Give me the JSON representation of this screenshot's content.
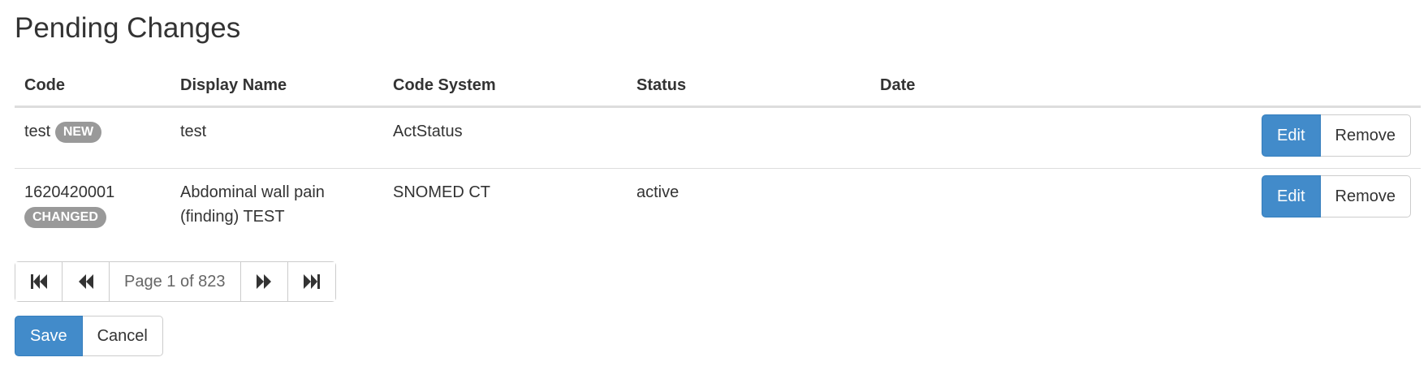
{
  "page": {
    "title": "Pending Changes"
  },
  "table": {
    "headers": {
      "code": "Code",
      "display_name": "Display Name",
      "code_system": "Code System",
      "status": "Status",
      "date": "Date"
    },
    "rows": [
      {
        "code": "test",
        "badge": "NEW",
        "display_name": "test",
        "display_name_line2": "",
        "code_system": "ActStatus",
        "status": "",
        "date": "",
        "edit_label": "Edit",
        "remove_label": "Remove"
      },
      {
        "code": "1620420001",
        "badge": "CHANGED",
        "display_name": "Abdominal wall pain",
        "display_name_line2": "(finding) TEST",
        "code_system": "SNOMED CT",
        "status": "active",
        "date": "",
        "edit_label": "Edit",
        "remove_label": "Remove"
      }
    ]
  },
  "pager": {
    "indicator": "Page 1 of 823",
    "first_icon": "first-page-icon",
    "prev_icon": "previous-page-icon",
    "next_icon": "next-page-icon",
    "last_icon": "last-page-icon"
  },
  "form": {
    "save_label": "Save",
    "cancel_label": "Cancel"
  },
  "colors": {
    "primary": "#428bca",
    "badge": "#999999",
    "border": "#dddddd"
  }
}
